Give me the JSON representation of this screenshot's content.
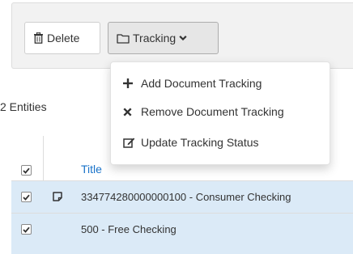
{
  "toolbar": {
    "delete_label": "Delete",
    "tracking_label": "Tracking",
    "delete_icon": "trash-icon",
    "tracking_icon": "folder-icon",
    "caret_icon": "chevron-down-icon"
  },
  "tracking_menu": {
    "items": [
      {
        "label": "Add Document Tracking",
        "icon": "plus-icon"
      },
      {
        "label": "Remove Document Tracking",
        "icon": "times-icon"
      },
      {
        "label": "Update Tracking Status",
        "icon": "edit-icon"
      }
    ]
  },
  "summary": {
    "count_text": "2 Entities"
  },
  "table": {
    "header": {
      "title": "Title",
      "select_all_checked": true
    },
    "rows": [
      {
        "checked": true,
        "has_note": true,
        "title": "334774280000000100 - Consumer Checking"
      },
      {
        "checked": true,
        "has_note": false,
        "title": "500 - Free Checking"
      }
    ]
  },
  "colors": {
    "accent_link": "#1a73c9",
    "selected_row": "#dbeaf7",
    "toolbar_bg": "#f2f2f2"
  }
}
